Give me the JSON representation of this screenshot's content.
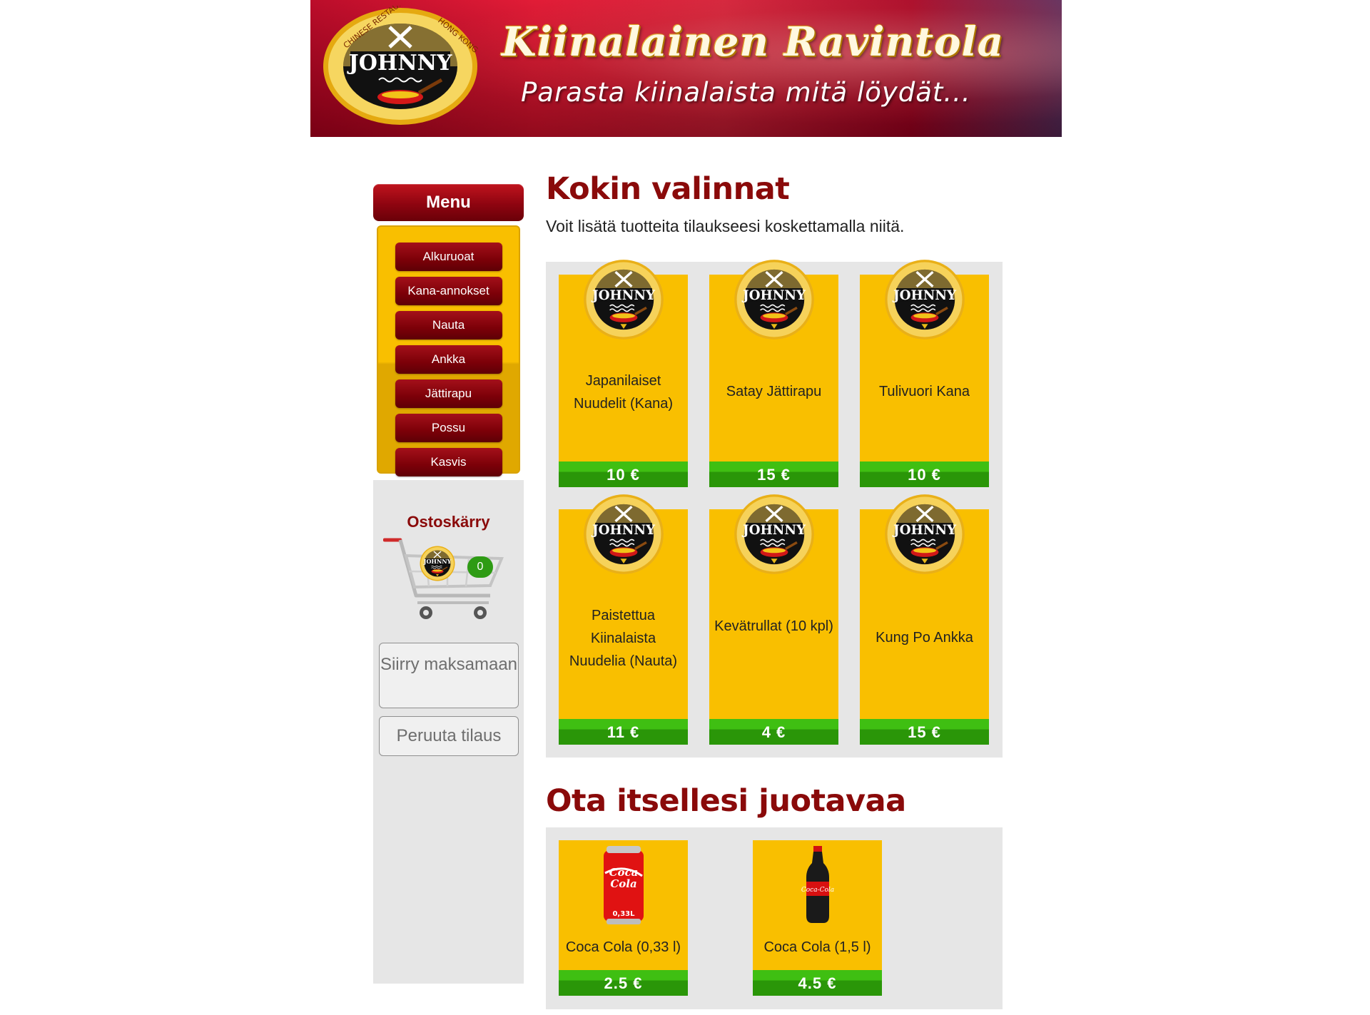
{
  "banner": {
    "title": "Kiinalainen Ravintola",
    "subtitle": "Parasta kiinalaista mitä löydät...",
    "logo_text": "JOHNNY",
    "logo_ring_top": "CHINESE RESTAURANT",
    "logo_ring_right": "HONG KONG"
  },
  "sidebar": {
    "menu_title": "Menu",
    "items": [
      {
        "label": "Alkuruoat"
      },
      {
        "label": "Kana-annokset"
      },
      {
        "label": "Nauta"
      },
      {
        "label": "Ankka"
      },
      {
        "label": "Jättirapu"
      },
      {
        "label": "Possu"
      },
      {
        "label": "Kasvis"
      }
    ],
    "cart": {
      "title": "Ostoskärry",
      "count": "0",
      "pay_button": "Siirry maksamaan",
      "cancel_button": "Peruuta tilaus"
    }
  },
  "main": {
    "chef_section": {
      "title": "Kokin valinnat",
      "intro": "Voit lisätä tuotteita tilaukseesi koskettamalla niitä.",
      "products": [
        {
          "name": "Japanilaiset Nuudelit (Kana)",
          "price": "10 €"
        },
        {
          "name": "Satay Jättirapu",
          "price": "15 €"
        },
        {
          "name": "Tulivuori Kana",
          "price": "10 €"
        },
        {
          "name": "Paistettua Kiinalaista Nuudelia (Nauta)",
          "price": "11 €"
        },
        {
          "name": "Kevätrullat (10 kpl)",
          "price": "4 €"
        },
        {
          "name": "Kung Po Ankka",
          "price": "15 €"
        }
      ]
    },
    "drinks_section": {
      "title": "Ota itsellesi juotavaa",
      "products": [
        {
          "name": "Coca Cola (0,33 l)",
          "price": "2.5 €",
          "image": "coca-cola-can"
        },
        {
          "name": "Coca Cola (1,5 l)",
          "price": "4.5 €",
          "image": "coca-cola-bottle"
        }
      ]
    }
  },
  "colors": {
    "brand_red": "#8a0a0a",
    "card_yellow": "#f9bf00",
    "price_green": "#2a9608",
    "panel_grey": "#e6e6e6"
  }
}
